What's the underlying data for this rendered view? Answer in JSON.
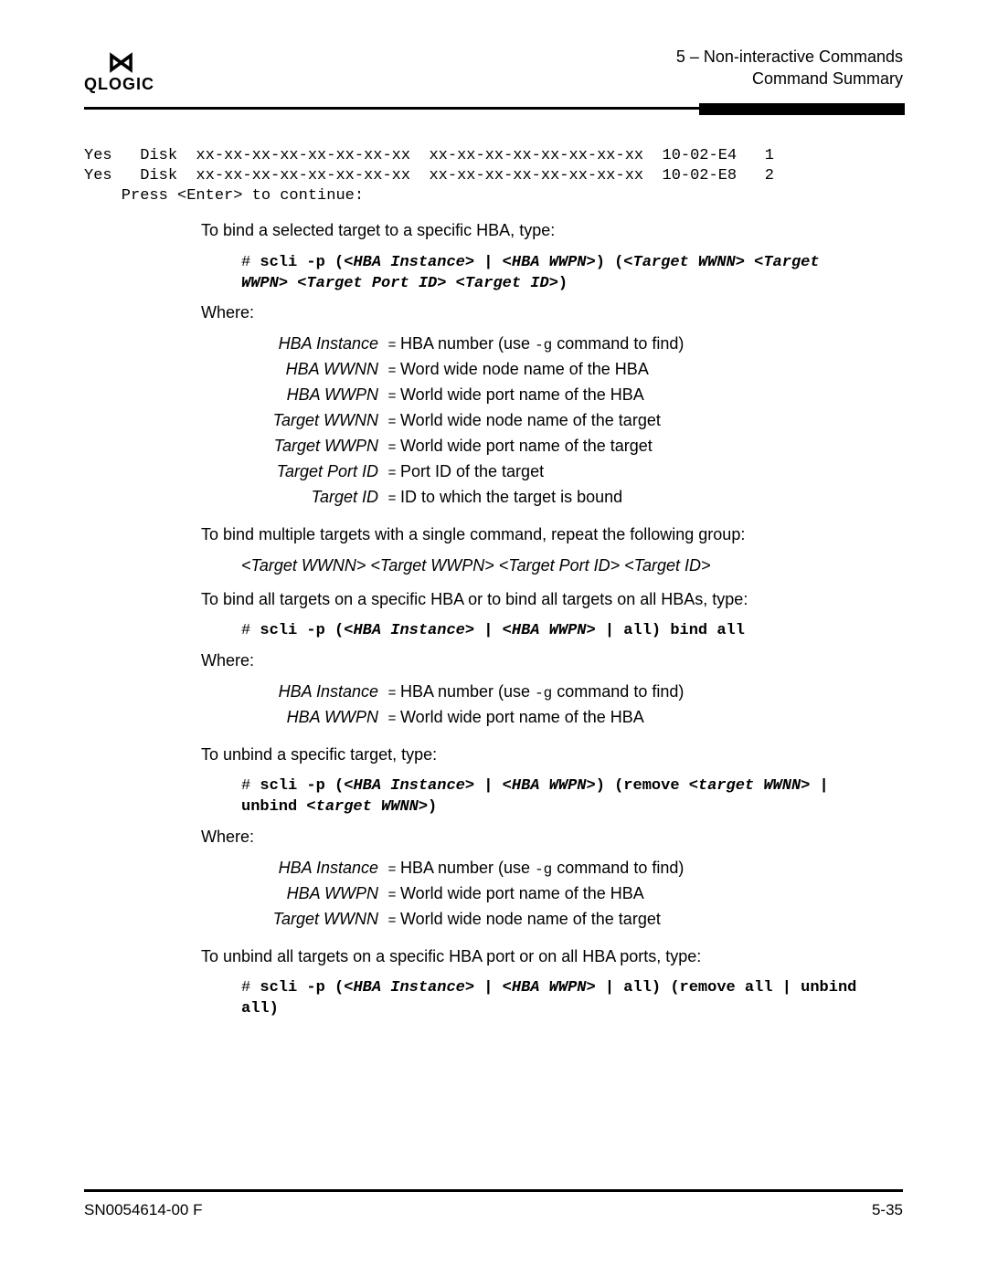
{
  "header": {
    "logo_text": "QLOGIC",
    "chapter_line": "5 – Non-interactive Commands",
    "section_line": "Command Summary"
  },
  "console": {
    "line1": "Yes   Disk  xx-xx-xx-xx-xx-xx-xx-xx  xx-xx-xx-xx-xx-xx-xx-xx  10-02-E4   1",
    "line2": "Yes   Disk  xx-xx-xx-xx-xx-xx-xx-xx  xx-xx-xx-xx-xx-xx-xx-xx  10-02-E8   2",
    "line3": "    Press <Enter> to continue:"
  },
  "para": {
    "p1": "To bind a selected target to a specific HBA, type:",
    "p2": "To bind multiple targets with a single command, repeat the following group:",
    "p3": "To bind all targets on a specific HBA or to bind all targets on all HBAs, type:",
    "p4": "To unbind a specific target, type:",
    "p5": "To unbind all targets on a specific HBA port or on all HBA ports, type:",
    "repeat": "<Target WWNN> <Target WWPN> <Target Port ID> <Target ID>",
    "where": "Where:"
  },
  "cmd": {
    "hash": "# ",
    "c1a": "scli -p (<",
    "c1b": "HBA Instance",
    "c1c": "> | <",
    "c1d": "HBA WWPN",
    "c1e": ">) (<",
    "c1f": "Target WWNN",
    "c1g": "> <",
    "c1h": "Target WWPN",
    "c1i": "> <",
    "c1j": "Target Port ID",
    "c1k": "> <",
    "c1l": "Target ID",
    "c1m": ">)",
    "c2a": "scli -p (<",
    "c2b": "HBA Instance",
    "c2c": "> | <",
    "c2d": "HBA WWPN",
    "c2e": "> | all) bind all",
    "c3a": "scli -p (<",
    "c3b": "HBA Instance",
    "c3c": "> | <",
    "c3d": "HBA WWPN",
    "c3e": ">) (remove <",
    "c3f": "target WWNN",
    "c3g": "> | unbind <",
    "c3h": "target WWNN",
    "c3i": ">)",
    "c4a": "scli -p (<",
    "c4b": "HBA Instance",
    "c4c": "> | <",
    "c4d": "HBA WWPN",
    "c4e": "> | all) (remove all | unbind all)"
  },
  "defs1": [
    {
      "term": "HBA Instance",
      "desc_pre": "HBA number (use ",
      "code": "-g",
      "desc_post": " command to find)"
    },
    {
      "term": "HBA WWNN",
      "desc_pre": "Word wide node name of the HBA",
      "code": "",
      "desc_post": ""
    },
    {
      "term": "HBA WWPN",
      "desc_pre": "World wide port name of the HBA",
      "code": "",
      "desc_post": ""
    },
    {
      "term": "Target WWNN",
      "desc_pre": "World wide node name of the target",
      "code": "",
      "desc_post": ""
    },
    {
      "term": "Target WWPN",
      "desc_pre": "World wide port name of the target",
      "code": "",
      "desc_post": ""
    },
    {
      "term": "Target Port ID",
      "desc_pre": "Port ID of the target",
      "code": "",
      "desc_post": ""
    },
    {
      "term": "Target ID",
      "desc_pre": "ID to which the target is bound",
      "code": "",
      "desc_post": ""
    }
  ],
  "defs2": [
    {
      "term": "HBA Instance",
      "desc_pre": "HBA number (use ",
      "code": "-g",
      "desc_post": " command to find)"
    },
    {
      "term": "HBA WWPN",
      "desc_pre": "World wide port name of the HBA",
      "code": "",
      "desc_post": ""
    }
  ],
  "defs3": [
    {
      "term": "HBA Instance",
      "desc_pre": "HBA number (use ",
      "code": "-g",
      "desc_post": " command to find)"
    },
    {
      "term": "HBA WWPN",
      "desc_pre": "World wide port name of the HBA",
      "code": "",
      "desc_post": ""
    },
    {
      "term": "Target WWNN",
      "desc_pre": "World wide node name of the target",
      "code": "",
      "desc_post": ""
    }
  ],
  "footer": {
    "left": "SN0054614-00 F",
    "right": "5-35"
  }
}
